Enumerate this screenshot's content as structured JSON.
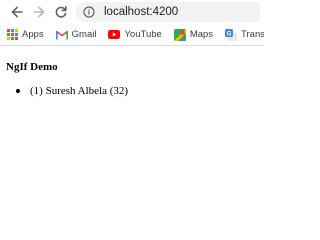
{
  "browser": {
    "url": "localhost:4200",
    "bookmarks": [
      {
        "label": "Apps",
        "icon": "apps-grid-icon"
      },
      {
        "label": "Gmail",
        "icon": "gmail-icon"
      },
      {
        "label": "YouTube",
        "icon": "youtube-icon"
      },
      {
        "label": "Maps",
        "icon": "maps-icon"
      },
      {
        "label": "Translate",
        "icon": "translate-icon"
      }
    ]
  },
  "page": {
    "heading": "NgIf Demo",
    "items": [
      {
        "text": "(1) Suresh Albela (32)"
      }
    ]
  }
}
